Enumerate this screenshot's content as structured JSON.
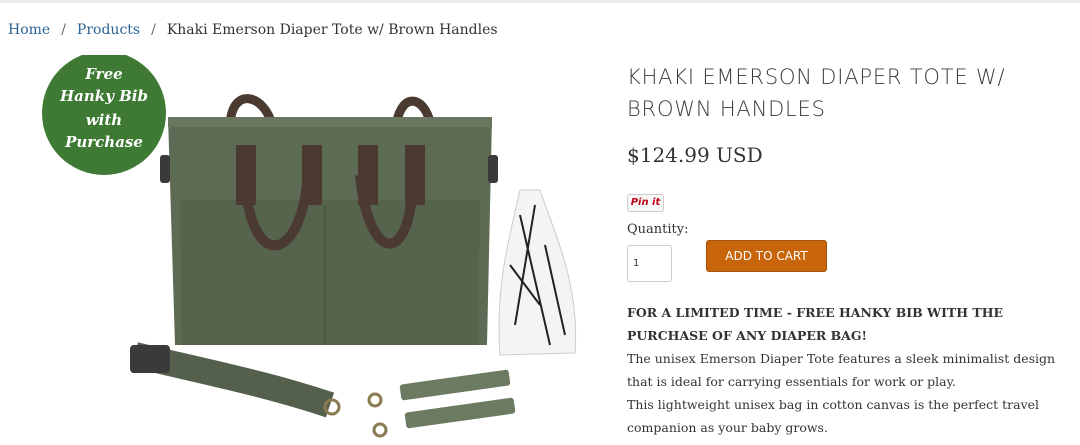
{
  "breadcrumb": {
    "home": "Home",
    "products": "Products",
    "current": "Khaki Emerson Diaper Tote w/ Brown Handles",
    "separator": "/"
  },
  "badge": {
    "line1": "Free",
    "line2": "Hanky Bib",
    "line3": "with",
    "line4": "Purchase"
  },
  "product": {
    "title": "KHAKI EMERSON DIAPER TOTE W/ BROWN HANDLES",
    "price": "$124.99 USD",
    "pin_label": "Pin it",
    "quantity_label": "Quantity:",
    "quantity_value": "1",
    "add_to_cart": "ADD TO CART"
  },
  "description": {
    "promo": "FOR A LIMITED TIME - FREE HANKY BIB WITH THE PURCHASE OF ANY DIAPER BAG!",
    "line1": "The unisex Emerson Diaper Tote features a sleek minimalist design that is ideal for carrying essentials for work or play.",
    "line2": "This lightweight unisex bag in cotton canvas is the perfect travel companion as your baby grows."
  },
  "colors": {
    "link": "#2a6496",
    "badge_green": "#3e7a34",
    "bag_green": "#5e6b54",
    "handle_brown": "#4a3a30",
    "button_orange": "#c8650a"
  }
}
